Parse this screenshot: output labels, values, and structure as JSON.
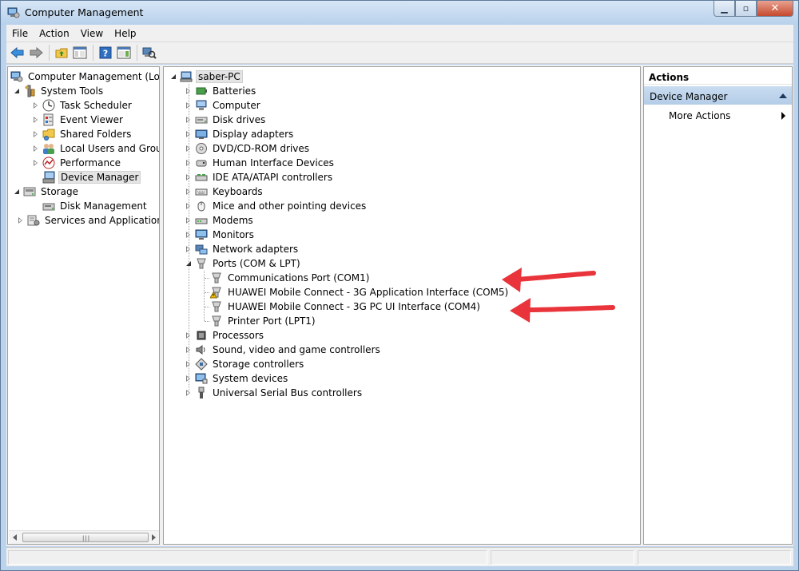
{
  "window": {
    "title": "Computer Management"
  },
  "menu": [
    "File",
    "Action",
    "View",
    "Help"
  ],
  "tree": {
    "root": "Computer Management (Local",
    "system_tools": "System Tools",
    "task_scheduler": "Task Scheduler",
    "event_viewer": "Event Viewer",
    "shared_folders": "Shared Folders",
    "local_users": "Local Users and Groups",
    "performance": "Performance",
    "device_manager": "Device Manager",
    "storage": "Storage",
    "disk_management": "Disk Management",
    "services": "Services and Applications"
  },
  "devices": {
    "root": "saber-PC",
    "categories": [
      "Batteries",
      "Computer",
      "Disk drives",
      "Display adapters",
      "DVD/CD-ROM drives",
      "Human Interface Devices",
      "IDE ATA/ATAPI controllers",
      "Keyboards",
      "Mice and other pointing devices",
      "Modems",
      "Monitors",
      "Network adapters",
      "Ports (COM & LPT)",
      "Processors",
      "Sound, video and game controllers",
      "Storage controllers",
      "System devices",
      "Universal Serial Bus controllers"
    ],
    "ports": [
      "Communications Port (COM1)",
      "HUAWEI Mobile Connect - 3G Application Interface (COM5)",
      "HUAWEI Mobile Connect - 3G PC UI Interface (COM4)",
      "Printer Port (LPT1)"
    ]
  },
  "actions": {
    "header": "Actions",
    "section": "Device Manager",
    "more": "More Actions"
  },
  "colors": {
    "annotation_arrow": "#e8343a",
    "selection": "#e4e4e4"
  }
}
